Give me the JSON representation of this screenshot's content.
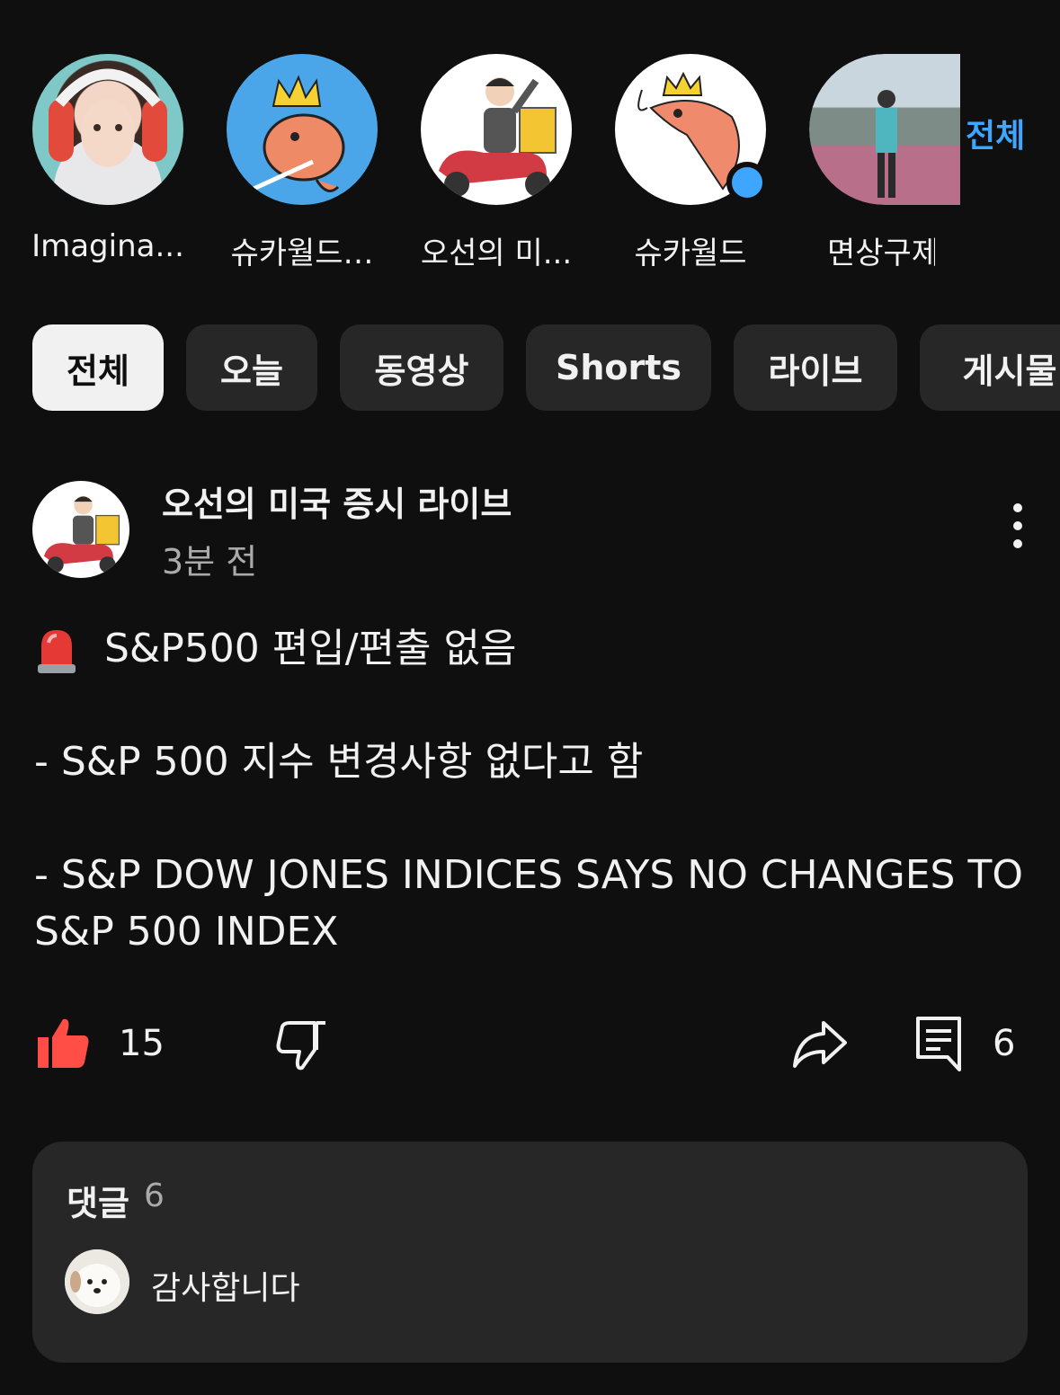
{
  "subscriptions": {
    "items": [
      {
        "name": "Imagina..."
      },
      {
        "name": "슈카월드…"
      },
      {
        "name": "오선의 미..."
      },
      {
        "name": "슈카월드"
      },
      {
        "name": "면상구제"
      }
    ],
    "all_label": "전체"
  },
  "chips": [
    "전체",
    "오늘",
    "동영상",
    "Shorts",
    "라이브",
    "게시물"
  ],
  "post": {
    "channel": "오선의 미국 증시 라이브",
    "time": "3분 전",
    "lines": [
      "S&P500 편입/편출 없음",
      "- S&P 500 지수 변경사항 없다고 함",
      "- S&P DOW JONES INDICES SAYS NO CHANGES TO S&P 500 INDEX"
    ],
    "likes": "15",
    "comments_count": "6"
  },
  "comments": {
    "title": "댓글",
    "count": "6",
    "top_comment": "감사합니다"
  },
  "colors": {
    "accent": "#3ea6ff",
    "like": "#ff4e45",
    "background": "#0f0f0f",
    "chip": "#272727"
  }
}
